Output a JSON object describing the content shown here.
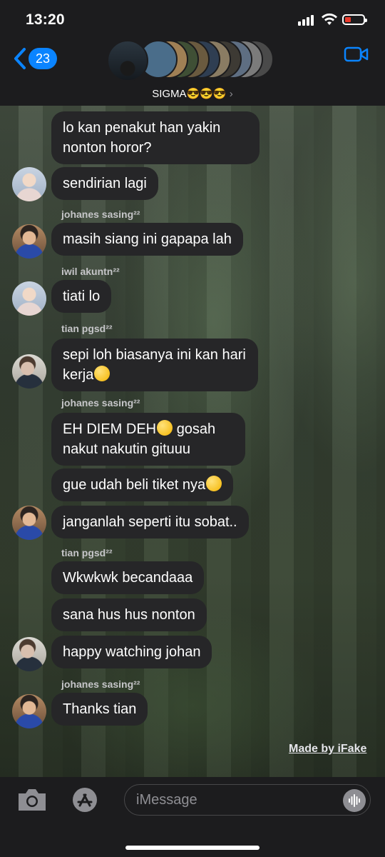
{
  "status_bar": {
    "time": "13:20"
  },
  "header": {
    "back_count": "23",
    "group_name": "SIGMA😎😎😎",
    "chevron": "›"
  },
  "messages": [
    {
      "sender": "",
      "text": "lo kan penakut han yakin nonton horor?"
    },
    {
      "sender": "",
      "text": "sendirian lagi"
    },
    {
      "sender": "johanes sasing²²",
      "text": "masih siang ini gapapa lah"
    },
    {
      "sender": "iwil akuntn²²",
      "text": "tiati lo"
    },
    {
      "sender": "tian pgsd²²",
      "text": "sepi loh biasanya ini kan hari kerja"
    },
    {
      "sender": "johanes sasing²²",
      "text": "EH DIEM DEH"
    },
    {
      "text": "gosah nakut nakutin gituuu"
    },
    {
      "text": "gue udah beli tiket nya"
    },
    {
      "text": "janganlah seperti itu sobat.."
    },
    {
      "sender": "tian pgsd²²",
      "text": "Wkwkwk becandaaa"
    },
    {
      "text": "sana hus hus nonton"
    },
    {
      "text": "happy watching johan"
    },
    {
      "sender": "johanes sasing²²",
      "text": "Thanks tian"
    }
  ],
  "footer": {
    "watermark": "Made by iFake",
    "input_placeholder": "iMessage"
  },
  "colors": {
    "accent": "#0a84ff",
    "bubble": "#262628",
    "bar": "#1c1c1e"
  },
  "icons": [
    "chevron-left-icon",
    "video-camera-icon",
    "camera-icon",
    "app-store-icon",
    "audio-waveform-icon"
  ]
}
